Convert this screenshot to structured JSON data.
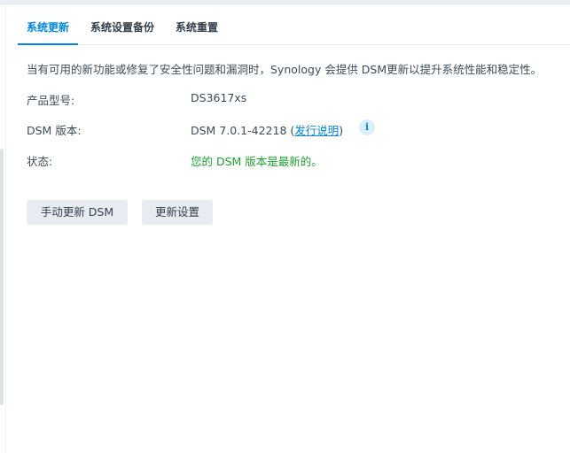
{
  "tabs": [
    {
      "label": "系统更新",
      "active": true
    },
    {
      "label": "系统设置备份",
      "active": false
    },
    {
      "label": "系统重置",
      "active": false
    }
  ],
  "description": "当有可用的新功能或修复了安全性问题和漏洞时，Synology 会提供 DSM更新以提升系统性能和稳定性。",
  "info": {
    "model_label": "产品型号:",
    "model_value": "DS3617xs",
    "version_label": "DSM 版本:",
    "version_value": "DSM 7.0.1-42218",
    "paren_open": " (",
    "release_notes_link": "发行说明",
    "paren_close": ")",
    "status_label": "状态:",
    "status_value": "您的 DSM 版本是最新的。"
  },
  "buttons": {
    "manual_update": "手动更新 DSM",
    "update_settings": "更新设置"
  },
  "colors": {
    "accent": "#0086e5",
    "ok": "#1ea132"
  },
  "icons": {
    "info": "i"
  }
}
